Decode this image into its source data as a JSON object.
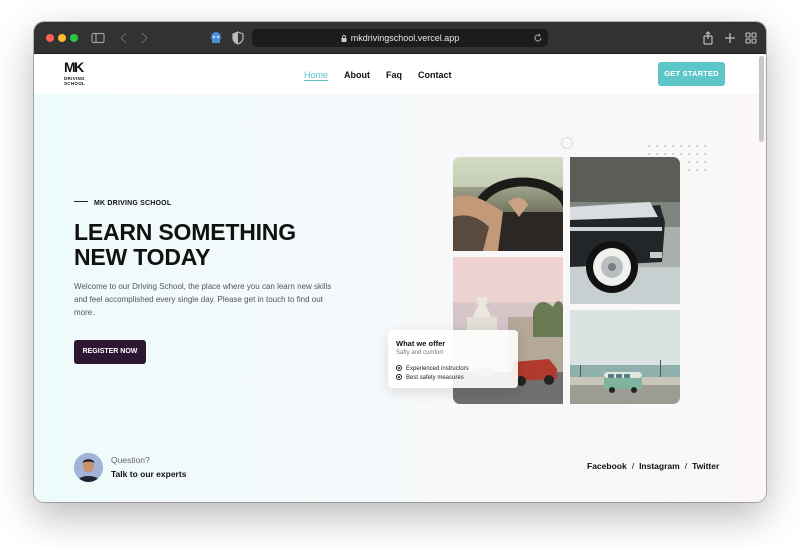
{
  "browser": {
    "url": "mkdrivingschool.vercel.app"
  },
  "nav": {
    "logo_text": "MK",
    "logo_sub": [
      "DRIVING",
      "SCHOOL"
    ],
    "links": [
      "Home",
      "About",
      "Faq",
      "Contact"
    ],
    "active": "Home",
    "cta": "GET STARTED"
  },
  "hero": {
    "eyebrow": "MK DRIVING SCHOOL",
    "headline_line1": "LEARN SOMETHING",
    "headline_line2": "NEW TODAY",
    "lead": "Welcome to our Driving School, the place where you can learn new skills and feel accomplished every single day. Please get in touch to find out more.",
    "button": "REGISTER NOW"
  },
  "offer": {
    "title": "What we offer",
    "subtitle": "Safty and comfort",
    "items": [
      "Experienced instructors",
      "Best safety measures"
    ]
  },
  "footer": {
    "question": "Question?",
    "cta": "Talk to our experts",
    "social": [
      "Facebook",
      "Instagram",
      "Twitter"
    ],
    "separator": "/"
  },
  "colors": {
    "accent": "#5dc6c9",
    "register_button": "#2e1733",
    "text": "#111111"
  },
  "icons": {
    "sidebar": "sidebar-toggle-icon",
    "back": "chevron-left-icon",
    "forward": "chevron-right-icon",
    "extension": "extension-icon",
    "privacy": "shield-icon",
    "lock": "lock-icon",
    "reload": "reload-icon",
    "share": "share-icon",
    "new_tab": "plus-icon",
    "tabs": "tab-overview-icon"
  }
}
